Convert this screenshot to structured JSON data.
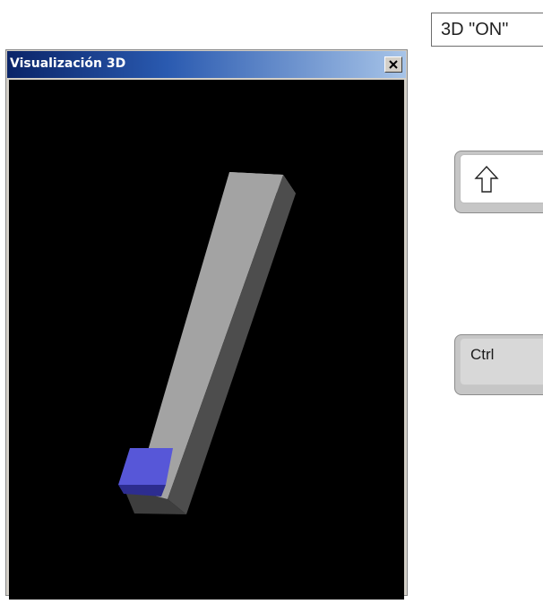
{
  "toggle_3d": {
    "label": "3D \"ON\""
  },
  "window": {
    "title": "Visualización 3D",
    "close_icon": "close-icon",
    "scene": {
      "bar_colors": {
        "front": "#a3a3a3",
        "side": "#4d4d4d",
        "top": "#bdbdbd"
      },
      "tool_color": "#5757d8"
    }
  },
  "keys": {
    "shift": {
      "icon": "shift-arrow-icon"
    },
    "ctrl": {
      "label": "Ctrl"
    }
  }
}
